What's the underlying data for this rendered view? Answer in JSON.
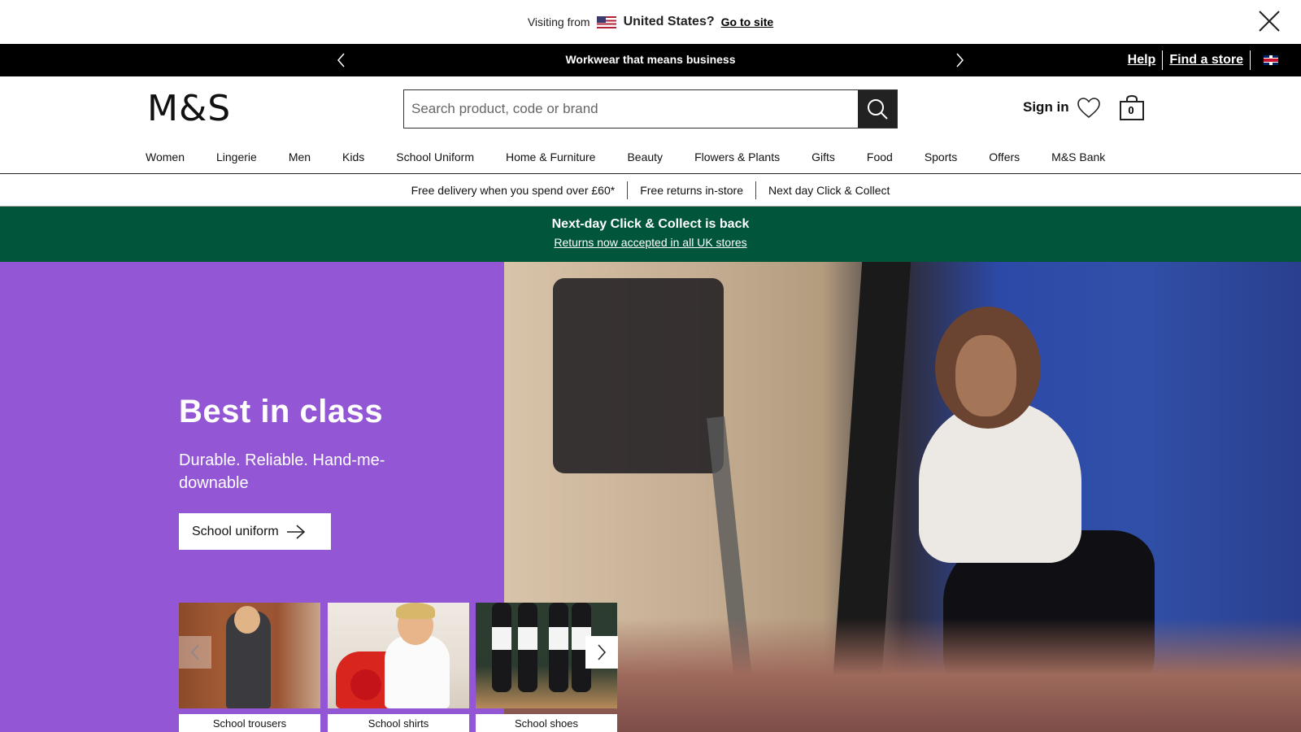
{
  "country_bar": {
    "visiting_label": "Visiting from",
    "country": "United States?",
    "goto_label": "Go to site"
  },
  "promo_bar": {
    "message": "Workwear that means business",
    "help_label": "Help",
    "store_label": "Find a store"
  },
  "header": {
    "logo": "M&S",
    "search_placeholder": "Search product, code or brand",
    "sign_in_label": "Sign in",
    "bag_count": "0"
  },
  "nav": {
    "items": [
      "Women",
      "Lingerie",
      "Men",
      "Kids",
      "School Uniform",
      "Home & Furniture",
      "Beauty",
      "Flowers & Plants",
      "Gifts",
      "Food",
      "Sports",
      "Offers",
      "M&S Bank"
    ]
  },
  "benefits": [
    "Free delivery when you spend over £60*",
    "Free returns in-store",
    "Next day Click & Collect"
  ],
  "banner": {
    "title": "Next-day Click & Collect is back",
    "link": "Returns now accepted in all UK stores"
  },
  "hero": {
    "title": "Best in class",
    "subtitle": "Durable. Reliable. Hand-me-downable",
    "cta_label": "School uniform"
  },
  "carousel": {
    "cards": [
      {
        "label": "School trousers"
      },
      {
        "label": "School shirts"
      },
      {
        "label": "School shoes"
      }
    ]
  },
  "colors": {
    "hero_left_bg": "#9357d5",
    "banner_bg": "#00553a",
    "promo_bg": "#000000"
  }
}
